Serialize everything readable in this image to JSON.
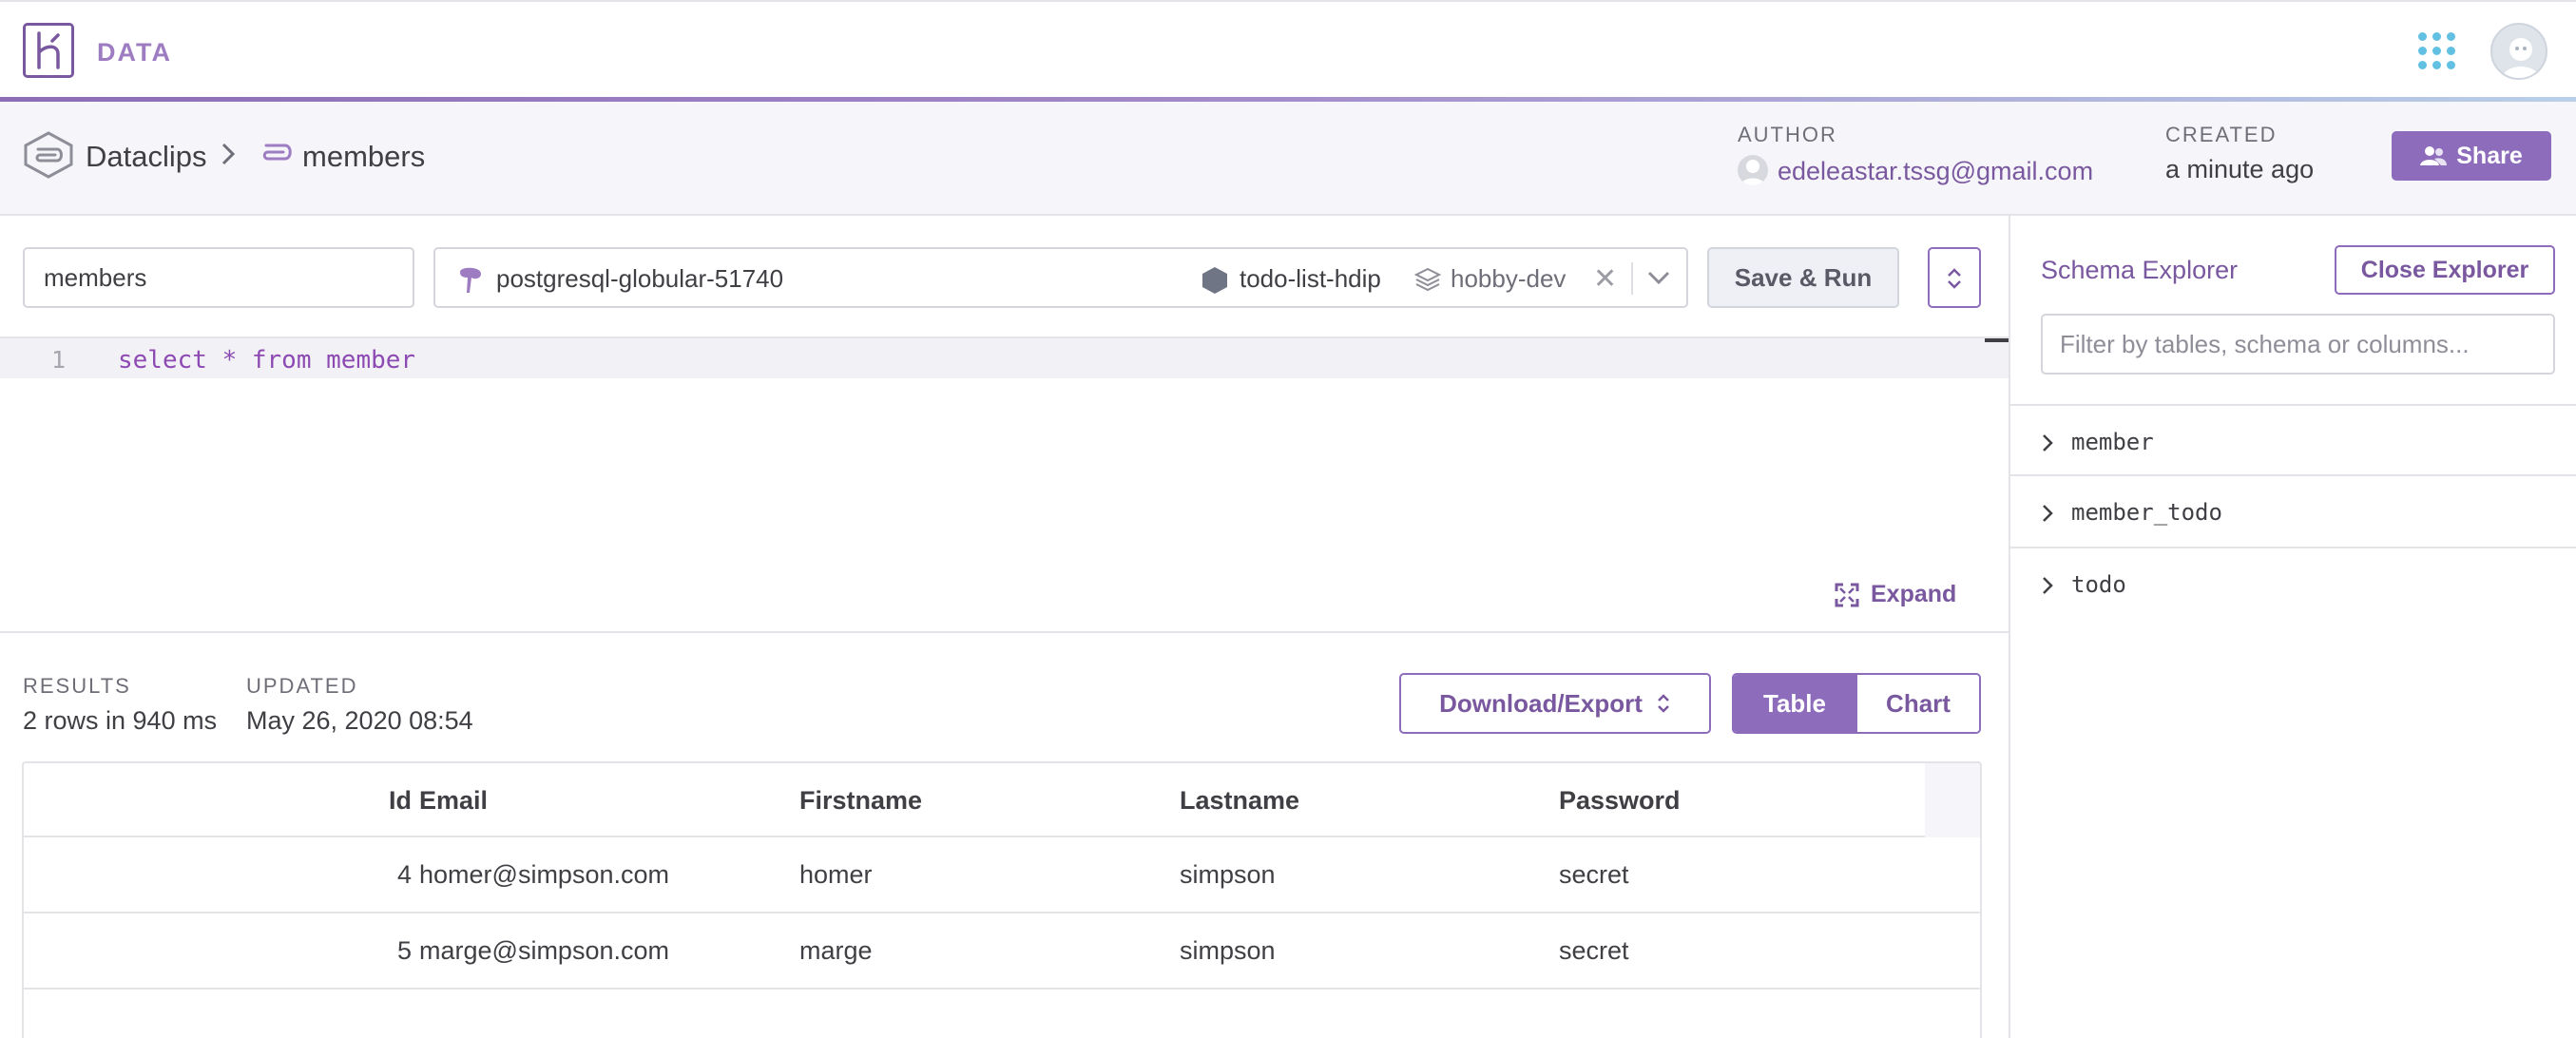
{
  "header": {
    "brand": "DATA"
  },
  "breadcrumb": {
    "root": "Dataclips",
    "current": "members"
  },
  "meta": {
    "author_label": "AUTHOR",
    "author_value": "edeleastar.tssg@gmail.com",
    "created_label": "CREATED",
    "created_value": "a minute ago"
  },
  "share_label": "Share",
  "toolbar": {
    "name_value": "members",
    "database": "postgresql-globular-51740",
    "app": "todo-list-hdip",
    "plan": "hobby-dev",
    "clear_symbol": "✕",
    "save_run_label": "Save & Run"
  },
  "editor": {
    "line_number": "1",
    "code": "select * from member",
    "expand_label": "Expand"
  },
  "results": {
    "results_label": "RESULTS",
    "results_value": "2 rows in 940 ms",
    "updated_label": "UPDATED",
    "updated_value": "May 26, 2020 08:54",
    "download_label": "Download/Export",
    "view_table": "Table",
    "view_chart": "Chart",
    "active_view": "Table"
  },
  "table": {
    "columns": [
      "Id",
      "Email",
      "Firstname",
      "Lastname",
      "Password"
    ],
    "rows": [
      [
        "4",
        "homer@simpson.com",
        "homer",
        "simpson",
        "secret"
      ],
      [
        "5",
        "marge@simpson.com",
        "marge",
        "simpson",
        "secret"
      ]
    ]
  },
  "schema": {
    "title": "Schema Explorer",
    "close_label": "Close Explorer",
    "filter_placeholder": "Filter by tables, schema or columns...",
    "tables": [
      "member",
      "member_todo",
      "todo"
    ]
  },
  "colors": {
    "accent": "#8d6cbc",
    "accent_text": "#79589f",
    "apps_icon": "#62c0e3",
    "code": "#8d4ab3"
  }
}
